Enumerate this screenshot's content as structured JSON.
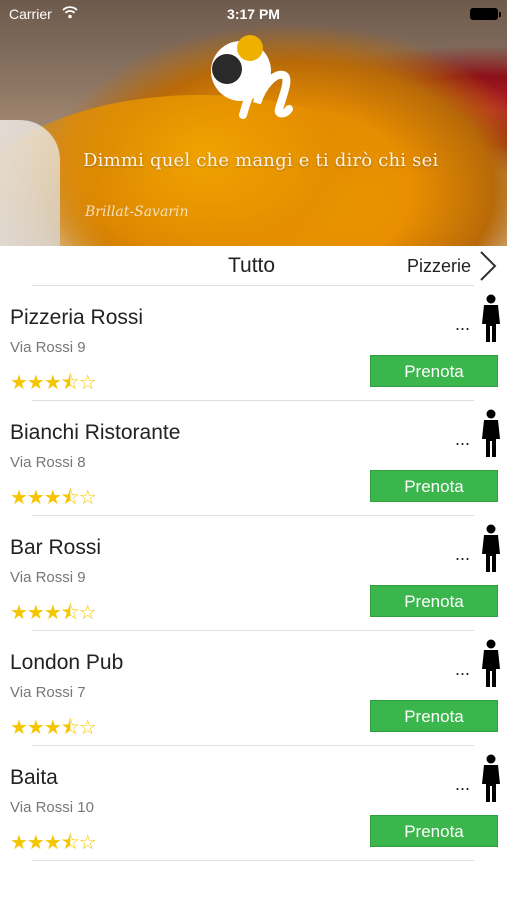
{
  "status_bar": {
    "carrier": "Carrier",
    "time": "3:17 PM"
  },
  "header": {
    "quote": "Dimmi quel che mangi e ti dirò chi sei",
    "author": "Brillat-Savarin"
  },
  "filter": {
    "current": "Tutto",
    "next": "Pizzerie"
  },
  "colors": {
    "accent_green": "#3bb64d",
    "star_yellow": "#f5c600"
  },
  "restaurants": [
    {
      "name": "Pizzeria Rossi",
      "address": "Via Rossi  9",
      "rating": 3.5,
      "stars": "★★★⯪☆",
      "more": "...",
      "button": "Prenota"
    },
    {
      "name": "Bianchi Ristorante",
      "address": "Via Rossi 8",
      "rating": 3.5,
      "stars": "★★★⯪☆",
      "more": "...",
      "button": "Prenota"
    },
    {
      "name": "Bar Rossi",
      "address": "Via Rossi 9",
      "rating": 3.5,
      "stars": "★★★⯪☆",
      "more": "...",
      "button": "Prenota"
    },
    {
      "name": "London Pub",
      "address": "Via Rossi 7",
      "rating": 3.5,
      "stars": "★★★⯪☆",
      "more": "...",
      "button": "Prenota"
    },
    {
      "name": "Baita",
      "address": "Via Rossi 10",
      "rating": 3.5,
      "stars": "★★★⯪☆",
      "more": "...",
      "button": "Prenota"
    }
  ]
}
